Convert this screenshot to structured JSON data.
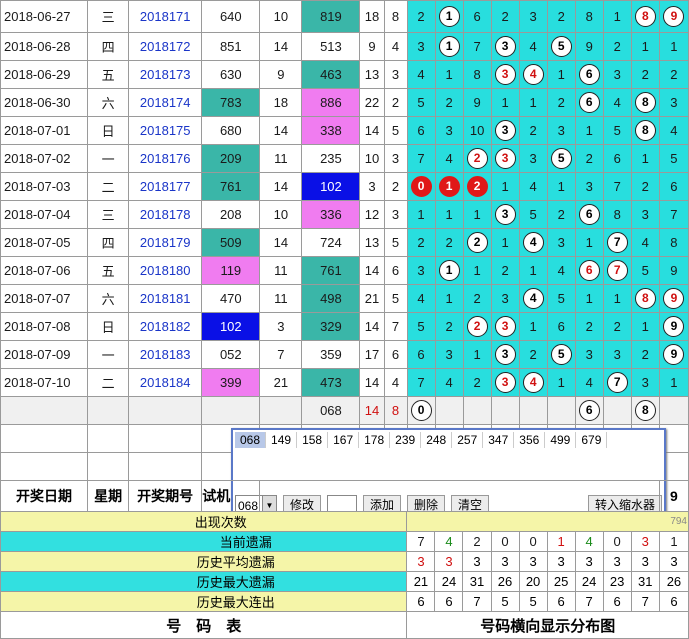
{
  "rows": [
    {
      "date": "2018-06-27",
      "wd": "三",
      "issue": "2018171",
      "test": "640",
      "tsum": "10",
      "draw": "819",
      "dsum": "18",
      "span": "8",
      "dist": [
        "2",
        "1",
        "6",
        "2",
        "3",
        "2",
        "8",
        "1",
        "8",
        "9"
      ]
    },
    {
      "date": "2018-06-28",
      "wd": "四",
      "issue": "2018172",
      "test": "851",
      "tsum": "14",
      "draw": "513",
      "dsum": "9",
      "span": "4",
      "dist": [
        "3",
        "1",
        "7",
        "3",
        "4",
        "5",
        "9",
        "2",
        "1",
        "1"
      ]
    },
    {
      "date": "2018-06-29",
      "wd": "五",
      "issue": "2018173",
      "test": "630",
      "tsum": "9",
      "draw": "463",
      "dsum": "13",
      "span": "3",
      "dist": [
        "4",
        "1",
        "8",
        "3",
        "4",
        "1",
        "6",
        "3",
        "2",
        "2"
      ]
    },
    {
      "date": "2018-06-30",
      "wd": "六",
      "issue": "2018174",
      "test": "783",
      "tsum": "18",
      "draw": "886",
      "dsum": "22",
      "span": "2",
      "dist": [
        "5",
        "2",
        "9",
        "1",
        "1",
        "2",
        "6",
        "4",
        "8",
        "3"
      ]
    },
    {
      "date": "2018-07-01",
      "wd": "日",
      "issue": "2018175",
      "test": "680",
      "tsum": "14",
      "draw": "338",
      "dsum": "14",
      "span": "5",
      "dist": [
        "6",
        "3",
        "10",
        "3",
        "2",
        "3",
        "1",
        "5",
        "8",
        "4"
      ]
    },
    {
      "date": "2018-07-02",
      "wd": "一",
      "issue": "2018176",
      "test": "209",
      "tsum": "11",
      "draw": "235",
      "dsum": "10",
      "span": "3",
      "dist": [
        "7",
        "4",
        "2",
        "3",
        "3",
        "5",
        "2",
        "6",
        "1",
        "5"
      ]
    },
    {
      "date": "2018-07-03",
      "wd": "二",
      "issue": "2018177",
      "test": "761",
      "tsum": "14",
      "draw": "102",
      "dsum": "3",
      "span": "2",
      "dist": [
        "0",
        "1",
        "2",
        "1",
        "4",
        "1",
        "3",
        "7",
        "2",
        "6"
      ]
    },
    {
      "date": "2018-07-04",
      "wd": "三",
      "issue": "2018178",
      "test": "208",
      "tsum": "10",
      "draw": "336",
      "dsum": "12",
      "span": "3",
      "dist": [
        "1",
        "1",
        "1",
        "3",
        "5",
        "2",
        "6",
        "8",
        "3",
        "7"
      ]
    },
    {
      "date": "2018-07-05",
      "wd": "四",
      "issue": "2018179",
      "test": "509",
      "tsum": "14",
      "draw": "724",
      "dsum": "13",
      "span": "5",
      "dist": [
        "2",
        "2",
        "2",
        "1",
        "4",
        "3",
        "1",
        "7",
        "4",
        "8"
      ]
    },
    {
      "date": "2018-07-06",
      "wd": "五",
      "issue": "2018180",
      "test": "119",
      "tsum": "11",
      "draw": "761",
      "dsum": "14",
      "span": "6",
      "dist": [
        "3",
        "1",
        "1",
        "2",
        "1",
        "4",
        "6",
        "7",
        "5",
        "9"
      ]
    },
    {
      "date": "2018-07-07",
      "wd": "六",
      "issue": "2018181",
      "test": "470",
      "tsum": "11",
      "draw": "498",
      "dsum": "21",
      "span": "5",
      "dist": [
        "4",
        "1",
        "2",
        "3",
        "4",
        "5",
        "1",
        "1",
        "8",
        "9"
      ]
    },
    {
      "date": "2018-07-08",
      "wd": "日",
      "issue": "2018182",
      "test": "102",
      "tsum": "3",
      "draw": "329",
      "dsum": "14",
      "span": "7",
      "dist": [
        "5",
        "2",
        "2",
        "3",
        "1",
        "6",
        "2",
        "2",
        "1",
        "9"
      ]
    },
    {
      "date": "2018-07-09",
      "wd": "一",
      "issue": "2018183",
      "test": "052",
      "tsum": "7",
      "draw": "359",
      "dsum": "17",
      "span": "6",
      "dist": [
        "6",
        "3",
        "1",
        "3",
        "2",
        "5",
        "3",
        "3",
        "2",
        "9"
      ]
    },
    {
      "date": "2018-07-10",
      "wd": "二",
      "issue": "2018184",
      "test": "399",
      "tsum": "21",
      "draw": "473",
      "dsum": "14",
      "span": "4",
      "dist": [
        "7",
        "4",
        "2",
        "3",
        "4",
        "1",
        "4",
        "7",
        "3",
        "1"
      ]
    }
  ],
  "colors": {
    "teal": "#3ab6a8",
    "pink": "#f07cf0",
    "blue": "#0a10e6",
    "cyan": "#28dede"
  },
  "predict": {
    "draw": "068",
    "dsum": "14",
    "span": "8",
    "balls": [
      "0",
      "6",
      "8"
    ]
  },
  "popup": {
    "chips": [
      "068",
      "149",
      "158",
      "167",
      "178",
      "239",
      "248",
      "257",
      "347",
      "356",
      "499",
      "679"
    ],
    "select_value": "068",
    "buttons": {
      "modify": "修改",
      "add": "添加",
      "delete": "删除",
      "clear": "清空",
      "transfer": "转入缩水器"
    }
  },
  "header": {
    "date": "开奖日期",
    "weekday": "星期",
    "issue": "开奖期号",
    "test": "试机",
    "right_digit": "9"
  },
  "stats": {
    "occurrences_label": "出现次数",
    "occurrences_right": "794",
    "current_miss_label": "当前遗漏",
    "current_miss": [
      "7",
      "4",
      "2",
      "0",
      "0",
      "1",
      "4",
      "0",
      "3",
      "1"
    ],
    "avg_miss_label": "历史平均遗漏",
    "avg_miss": [
      "3",
      "3",
      "3",
      "3",
      "3",
      "3",
      "3",
      "3",
      "3",
      "3"
    ],
    "max_miss_label": "历史最大遗漏",
    "max_miss": [
      "21",
      "24",
      "31",
      "26",
      "20",
      "25",
      "24",
      "23",
      "31",
      "26"
    ],
    "max_streak_label": "历史最大连出",
    "max_streak": [
      "6",
      "6",
      "7",
      "5",
      "5",
      "6",
      "7",
      "6",
      "7",
      "6"
    ]
  },
  "footer": {
    "left": "号　码　表",
    "right": "号码横向显示分布图"
  }
}
